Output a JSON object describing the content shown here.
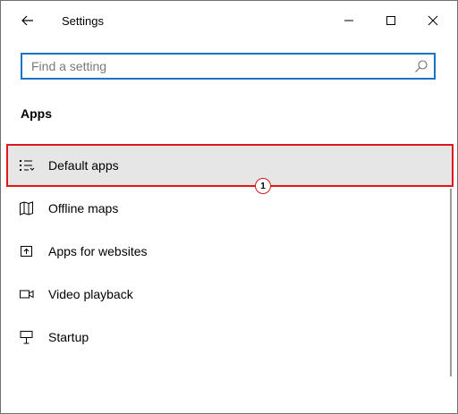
{
  "window": {
    "title": "Settings"
  },
  "search": {
    "placeholder": "Find a setting",
    "value": ""
  },
  "section": {
    "heading": "Apps"
  },
  "nav": {
    "items": [
      {
        "label": "Default apps",
        "icon": "default-apps-icon",
        "selected": true
      },
      {
        "label": "Offline maps",
        "icon": "map-icon",
        "selected": false
      },
      {
        "label": "Apps for websites",
        "icon": "open-in-app-icon",
        "selected": false
      },
      {
        "label": "Video playback",
        "icon": "video-icon",
        "selected": false
      },
      {
        "label": "Startup",
        "icon": "startup-icon",
        "selected": false
      }
    ]
  },
  "annotation": {
    "step": "1",
    "color": "#e0161e"
  },
  "colors": {
    "accent": "#1a73c7",
    "selected_bg": "#e6e6e6"
  }
}
